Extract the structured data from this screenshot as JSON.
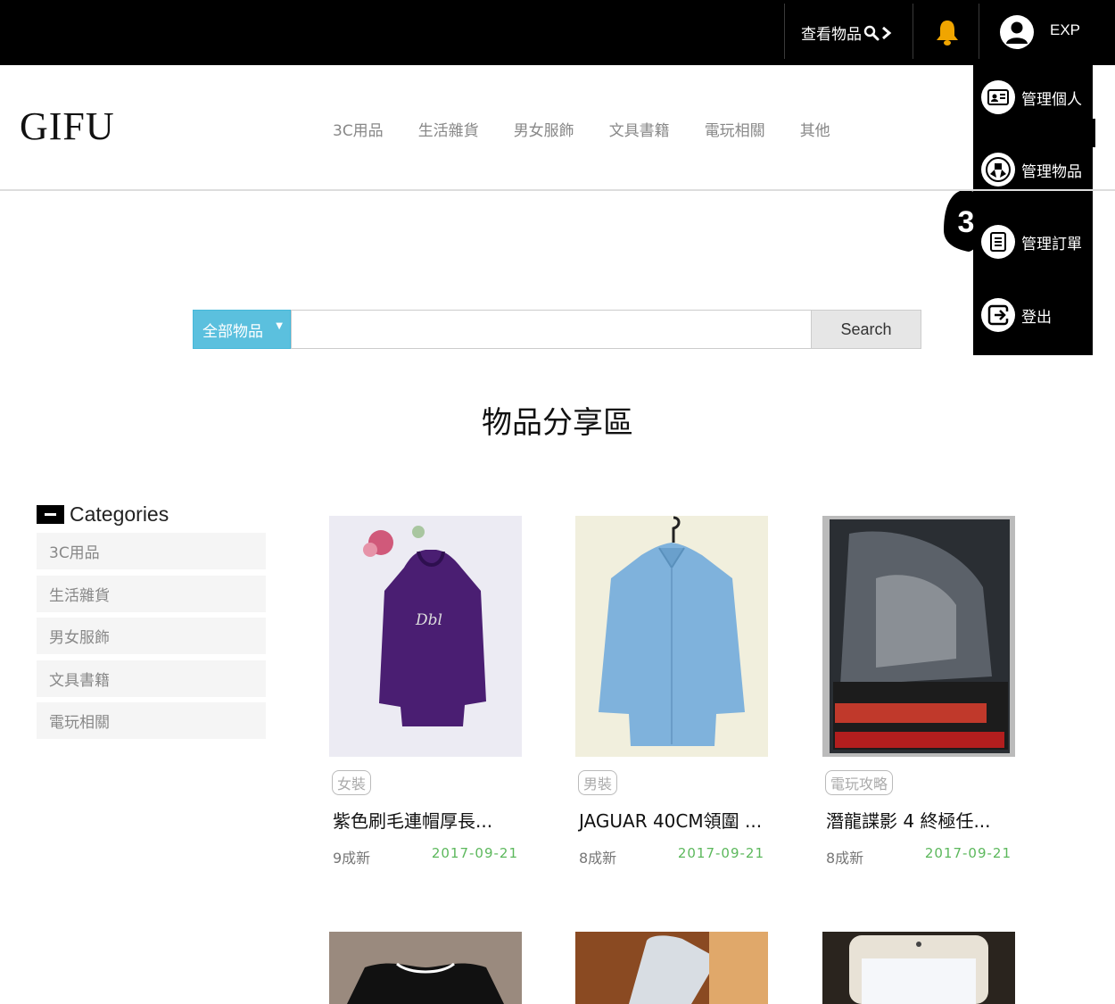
{
  "topbar": {
    "browse_label": "查看物品",
    "username": "EXP"
  },
  "user_menu": {
    "items": [
      {
        "label": "管理個人",
        "icon": "profile-card-icon"
      },
      {
        "label": "管理物品",
        "icon": "gift-hands-icon"
      },
      {
        "label": "管理訂單",
        "icon": "order-list-icon"
      },
      {
        "label": "登出",
        "icon": "logout-icon"
      }
    ],
    "step_badge": "3"
  },
  "header": {
    "logo": "GIFU",
    "nav": [
      "3C用品",
      "生活雜貨",
      "男女服飾",
      "文具書籍",
      "電玩相關",
      "其他"
    ]
  },
  "search": {
    "category": "全部物品",
    "value": "",
    "button": "Search"
  },
  "section_title": "物品分享區",
  "categories": {
    "title": "Categories",
    "items": [
      "3C用品",
      "生活雜貨",
      "男女服飾",
      "文具書籍",
      "電玩相關"
    ]
  },
  "items": [
    {
      "tag": "女裝",
      "name": "紫色刷毛連帽厚長...",
      "condition": "9成新",
      "date": "2017-09-21"
    },
    {
      "tag": "男裝",
      "name": "JAGUAR 40CM領圍 ...",
      "condition": "8成新",
      "date": "2017-09-21"
    },
    {
      "tag": "電玩攻略",
      "name": "潛龍諜影 4 終極任...",
      "condition": "8成新",
      "date": "2017-09-21"
    }
  ],
  "colors": {
    "topbar_bg": "#000000",
    "search_category_bg": "#5bc0de",
    "date_green": "#5cb85c",
    "bell": "#f0a500"
  }
}
